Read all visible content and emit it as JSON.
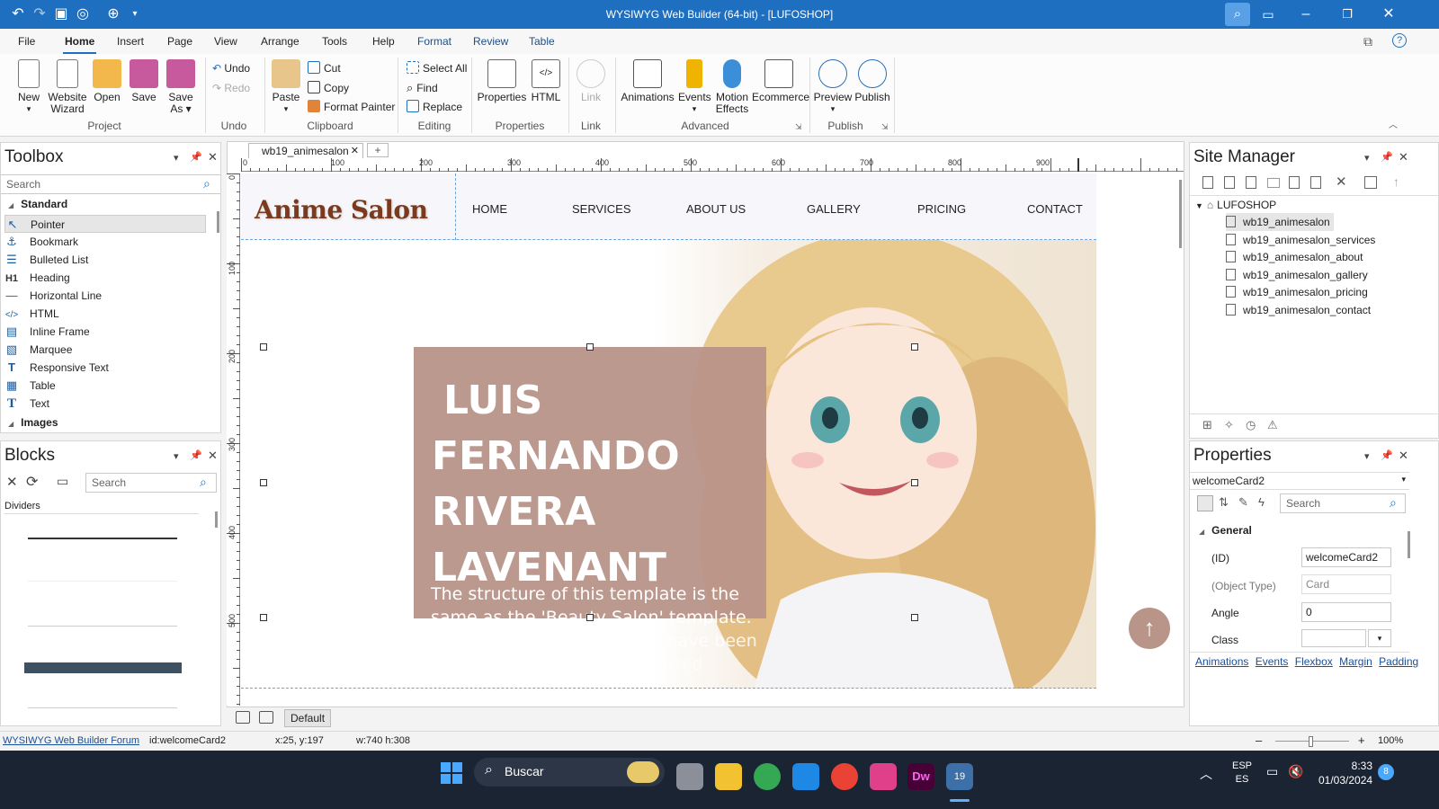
{
  "window": {
    "title": "WYSIWYG Web Builder (64-bit) - [LUFOSHOP]"
  },
  "menu": [
    "File",
    "Home",
    "Insert",
    "Page",
    "View",
    "Arrange",
    "Tools",
    "Help",
    "Format",
    "Review",
    "Table"
  ],
  "ribbon": {
    "project": {
      "new": "New",
      "wizard_1": "Website",
      "wizard_2": "Wizard",
      "open": "Open",
      "save": "Save",
      "saveas_1": "Save",
      "saveas_2": "As",
      "label": "Project"
    },
    "undo": {
      "undo": "Undo",
      "redo": "Redo",
      "label": "Undo"
    },
    "clipboard": {
      "paste": "Paste",
      "cut": "Cut",
      "copy": "Copy",
      "format_painter": "Format Painter",
      "label": "Clipboard"
    },
    "editing": {
      "select_all": "Select All",
      "find": "Find",
      "replace": "Replace",
      "label": "Editing"
    },
    "properties": {
      "properties": "Properties",
      "html": "HTML",
      "label": "Properties"
    },
    "link": {
      "link": "Link",
      "label": "Link"
    },
    "advanced": {
      "animations": "Animations",
      "events": "Events",
      "motion_1": "Motion",
      "motion_2": "Effects",
      "ecommerce": "Ecommerce",
      "label": "Advanced"
    },
    "publish": {
      "preview": "Preview",
      "publish": "Publish",
      "label": "Publish"
    }
  },
  "toolbox": {
    "title": "Toolbox",
    "search_placeholder": "Search",
    "category": "Standard",
    "items": [
      "Pointer",
      "Bookmark",
      "Bulleted List",
      "Heading",
      "Horizontal Line",
      "HTML",
      "Inline Frame",
      "Marquee",
      "Responsive Text",
      "Table",
      "Text"
    ],
    "category2": "Images"
  },
  "blocks": {
    "title": "Blocks",
    "search_placeholder": "Search",
    "category": "Dividers"
  },
  "document_tab": "wb19_animesalon",
  "ruler_marks": [
    "0",
    "100",
    "200",
    "300",
    "400",
    "500",
    "600",
    "700",
    "800",
    "900"
  ],
  "vruler_marks": [
    "0",
    "100",
    "200",
    "300",
    "400",
    "500"
  ],
  "page": {
    "logo": "Anime Salon",
    "nav": [
      "HOME",
      "SERVICES",
      "ABOUT US",
      "GALLERY",
      "PRICING",
      "CONTACT"
    ],
    "hero_name": [
      "LUIS",
      "FERNANDO",
      "RIVERA",
      "LAVENANT"
    ],
    "hero_text_1": "The structure of this template is the",
    "hero_text_2": "same as the 'Beauty Salon' template.",
    "hero_text_3": "es have been",
    "hero_text_4": "ported"
  },
  "canvas_bottom": {
    "default_label": "Default"
  },
  "site_manager": {
    "title": "Site Manager",
    "root": "LUFOSHOP",
    "pages": [
      "wb19_animesalon",
      "wb19_animesalon_services",
      "wb19_animesalon_about",
      "wb19_animesalon_gallery",
      "wb19_animesalon_pricing",
      "wb19_animesalon_contact"
    ]
  },
  "properties": {
    "title": "Properties",
    "object": "welcomeCard2",
    "search_placeholder": "Search",
    "section": "General",
    "rows": [
      {
        "label": "(ID)",
        "value": "welcomeCard2"
      },
      {
        "label": "(Object Type)",
        "value": "Card"
      },
      {
        "label": "Angle",
        "value": "0"
      },
      {
        "label": "Class",
        "value": ""
      }
    ],
    "links": [
      "Animations",
      "Events",
      "Flexbox",
      "Margin",
      "Padding"
    ]
  },
  "status": {
    "forum": "WYSIWYG Web Builder Forum",
    "id": "id:welcomeCard2",
    "pos": "x:25, y:197",
    "size": "w:740 h:308",
    "zoom": "100%"
  },
  "taskbar": {
    "search": "Buscar",
    "lang_1": "ESP",
    "lang_2": "ES",
    "time": "8:33",
    "date": "01/03/2024",
    "badge": "8"
  },
  "colors": {
    "accent": "#1e6fbf",
    "hero_card": "#b89489",
    "logo_dark": "#7b3a1e",
    "logo_light": "#c08a5a"
  }
}
